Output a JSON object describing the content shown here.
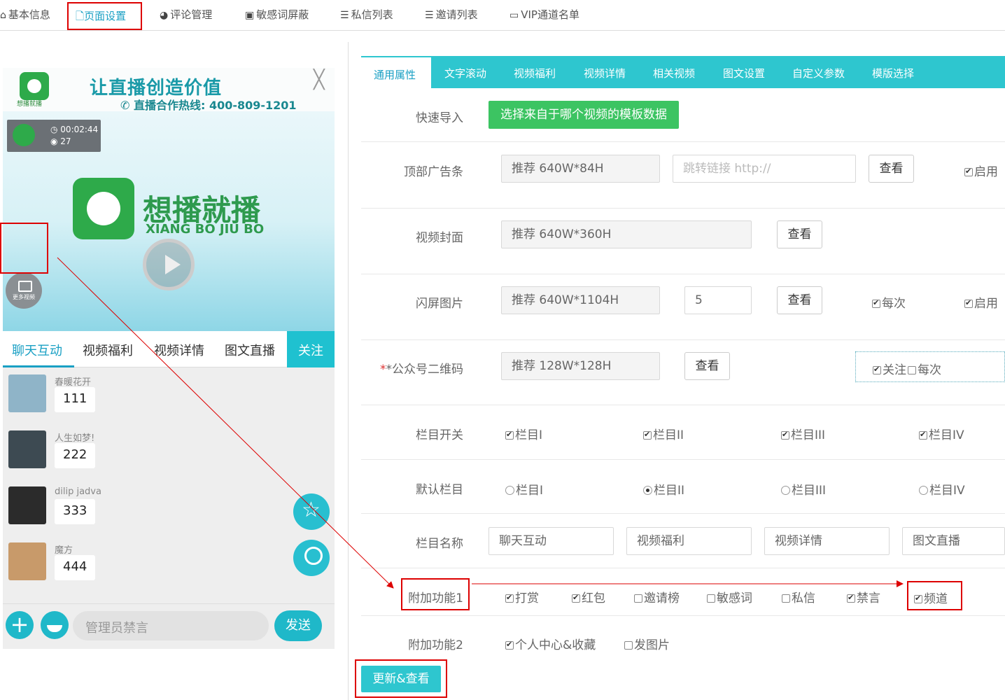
{
  "topnav": {
    "items": [
      {
        "label": "基本信息",
        "icon": "home-icon"
      },
      {
        "label": "页面设置",
        "icon": "file-icon"
      },
      {
        "label": "评论管理",
        "icon": "wechat-icon"
      },
      {
        "label": "敏感词屏蔽",
        "icon": "word-icon"
      },
      {
        "label": "私信列表",
        "icon": "list-icon"
      },
      {
        "label": "邀请列表",
        "icon": "list-icon"
      },
      {
        "label": "VIP通道名单",
        "icon": "card-icon"
      }
    ]
  },
  "preview": {
    "banner": {
      "title": "让直播创造价值",
      "hotline": "直播合作热线: 400-809-1201",
      "logo_sub": "想播就播"
    },
    "video": {
      "time": "00:02:44",
      "views": "27",
      "brand": "想播就播",
      "brand_sub": "XIANG BO JIU BO",
      "more_label": "更多视频"
    },
    "tabs": [
      "聊天互动",
      "视频福利",
      "视频详情",
      "图文直播"
    ],
    "follow": "关注",
    "messages": [
      {
        "name": "春暖花开",
        "text": "111",
        "color": "#8fb4c8"
      },
      {
        "name": "人生如梦!",
        "text": "222",
        "color": "#3d4a52"
      },
      {
        "name": "dilip jadva",
        "text": "333",
        "color": "#2b2b2b"
      },
      {
        "name": "魔方",
        "text": "444",
        "color": "#c89a6a"
      }
    ],
    "input_placeholder": "管理员禁言",
    "send": "发送"
  },
  "form": {
    "tabs": [
      "通用属性",
      "文字滚动",
      "视频福利",
      "视频详情",
      "相关视频",
      "图文设置",
      "自定义参数",
      "模版选择"
    ],
    "quick_import": {
      "label": "快速导入",
      "button": "选择来自于哪个视频的模板数据"
    },
    "top_ad": {
      "label": "顶部广告条",
      "value": "推荐 640W*84H",
      "link_placeholder": "跳转链接 http://",
      "view": "查看",
      "enable": "启用"
    },
    "cover": {
      "label": "视频封面",
      "value": "推荐 640W*360H",
      "view": "查看"
    },
    "splash": {
      "label": "闪屏图片",
      "value": "推荐 640W*1104H",
      "seconds": "5",
      "view": "查看",
      "each": "每次",
      "enable": "启用"
    },
    "qrcode": {
      "label": "*公众号二维码",
      "value": "推荐 128W*128H",
      "view": "查看",
      "follow": "关注",
      "each": "每次"
    },
    "column_switch": {
      "label": "栏目开关",
      "items": [
        "栏目I",
        "栏目II",
        "栏目III",
        "栏目IV"
      ]
    },
    "default_column": {
      "label": "默认栏目",
      "items": [
        "栏目I",
        "栏目II",
        "栏目III",
        "栏目IV"
      ],
      "selected": 1
    },
    "column_names": {
      "label": "栏目名称",
      "values": [
        "聊天互动",
        "视频福利",
        "视频详情",
        "图文直播"
      ]
    },
    "extra1": {
      "label": "附加功能1",
      "items": [
        {
          "label": "打赏",
          "checked": true
        },
        {
          "label": "红包",
          "checked": true
        },
        {
          "label": "邀请榜",
          "checked": false
        },
        {
          "label": "敏感词",
          "checked": false
        },
        {
          "label": "私信",
          "checked": false
        },
        {
          "label": "禁言",
          "checked": true
        },
        {
          "label": "频道",
          "checked": true
        }
      ]
    },
    "extra2": {
      "label": "附加功能2",
      "items": [
        {
          "label": "个人中心&收藏",
          "checked": true
        },
        {
          "label": "发图片",
          "checked": false
        }
      ]
    },
    "submit": "更新&查看"
  },
  "colors": {
    "accent": "#2ec6cf",
    "green": "#3cc462",
    "annotation": "#dd0000"
  }
}
